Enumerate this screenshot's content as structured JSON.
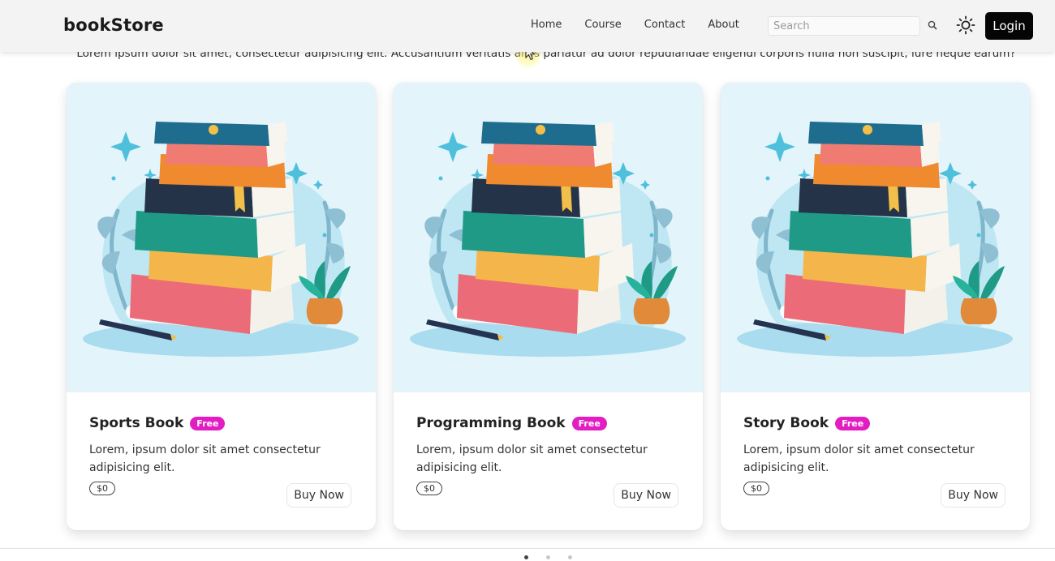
{
  "navbar": {
    "brand": "bookStore",
    "links": [
      "Home",
      "Course",
      "Contact",
      "About"
    ],
    "search_placeholder": "Search",
    "login_label": "Login"
  },
  "intro_text": "Lorem ipsum dolor sit amet, consectetur adipisicing elit. Accusantium veritatis alias pariatur ad dolor repudiandae eligendi corporis nulla non suscipit, iure neque earum?",
  "cards": [
    {
      "title": "Sports Book",
      "badge": "Free",
      "description": "Lorem, ipsum dolor sit amet consectetur adipisicing elit.",
      "price": "$0",
      "button": "Buy Now"
    },
    {
      "title": "Programming Book",
      "badge": "Free",
      "description": "Lorem, ipsum dolor sit amet consectetur adipisicing elit.",
      "price": "$0",
      "button": "Buy Now"
    },
    {
      "title": "Story Book",
      "badge": "Free",
      "description": "Lorem, ipsum dolor sit amet consectetur adipisicing elit.",
      "price": "$0",
      "button": "Buy Now"
    }
  ],
  "carousel": {
    "total_pages": 3,
    "active_page": 1
  },
  "colors": {
    "badge": "#e21ec3",
    "login_bg": "#050505",
    "card_media_bg": "#e3f4fb",
    "navbar_bg": "#f3f3f3"
  },
  "icons": {
    "search": "search-icon",
    "theme": "sun-icon"
  }
}
